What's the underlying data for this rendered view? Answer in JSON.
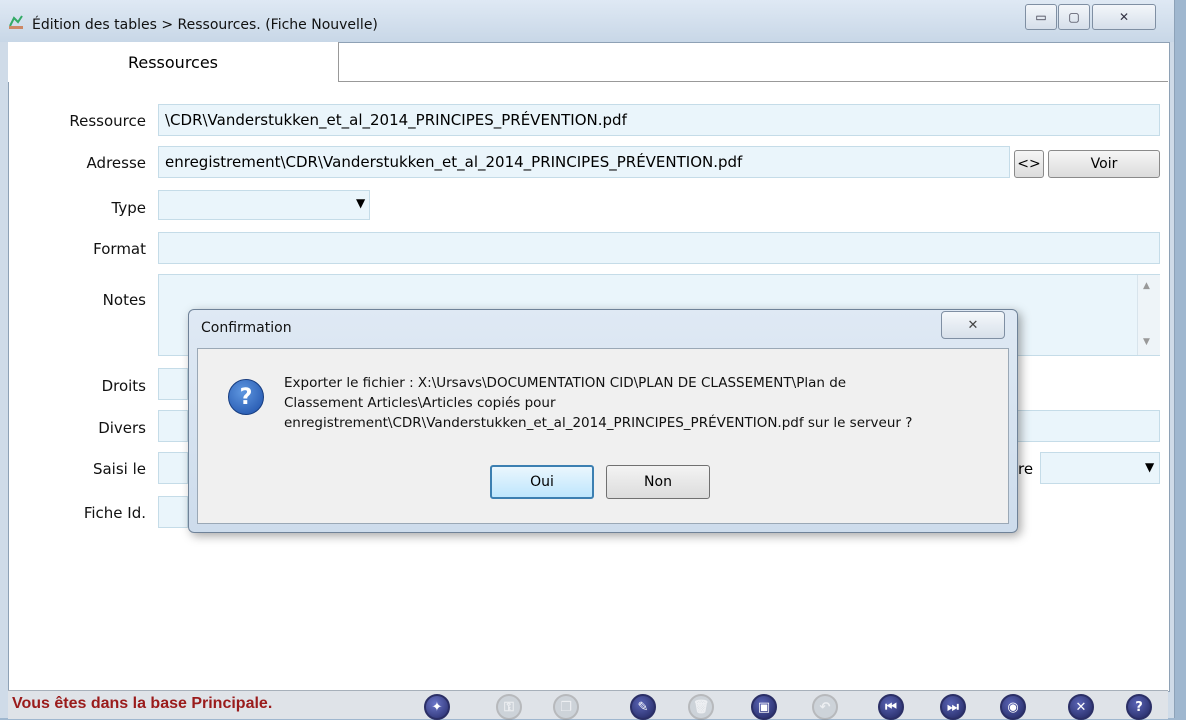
{
  "window": {
    "title": "Édition des tables > Ressources.  (Fiche Nouvelle)",
    "minimize_label": "▭",
    "maximize_label": "▢",
    "close_label": "✕"
  },
  "tabs": [
    {
      "label": "Ressources",
      "selected": true
    }
  ],
  "form": {
    "ressource_label": "Ressource",
    "ressource_value": "\\CDR\\Vanderstukken_et_al_2014_PRINCIPES_PRÉVENTION.pdf",
    "adresse_label": "Adresse",
    "adresse_value": "enregistrement\\CDR\\Vanderstukken_et_al_2014_PRINCIPES_PRÉVENTION.pdf",
    "browse_button": "<>",
    "voir_button": "Voir",
    "type_label": "Type",
    "type_value": "",
    "format_label": "Format",
    "notes_label": "Notes",
    "droits_label": "Droits",
    "divers_label": "Divers",
    "saisi_label": "Saisi le",
    "fiche_label": "Fiche Id.",
    "partial_right_label": "re"
  },
  "dialog": {
    "title": "Confirmation",
    "close_label": "✕",
    "message_line1": "Exporter le fichier : X:\\Ursavs\\DOCUMENTATION CID\\PLAN DE CLASSEMENT\\Plan de",
    "message_line2": "Classement Articles\\Articles copiés pour",
    "message_line3": "enregistrement\\CDR\\Vanderstukken_et_al_2014_PRINCIPES_PRÉVENTION.pdf sur le serveur ?",
    "oui_label": "Oui",
    "non_label": "Non"
  },
  "status": {
    "text": "Vous êtes dans la base Principale."
  },
  "toolbar": {
    "icons": [
      "new-record-icon",
      "key-icon",
      "copy-icon",
      "edit-icon",
      "delete-icon",
      "save-icon",
      "undo-icon",
      "first-record-icon",
      "last-record-icon",
      "view-icon",
      "close-icon",
      "help-icon"
    ]
  }
}
